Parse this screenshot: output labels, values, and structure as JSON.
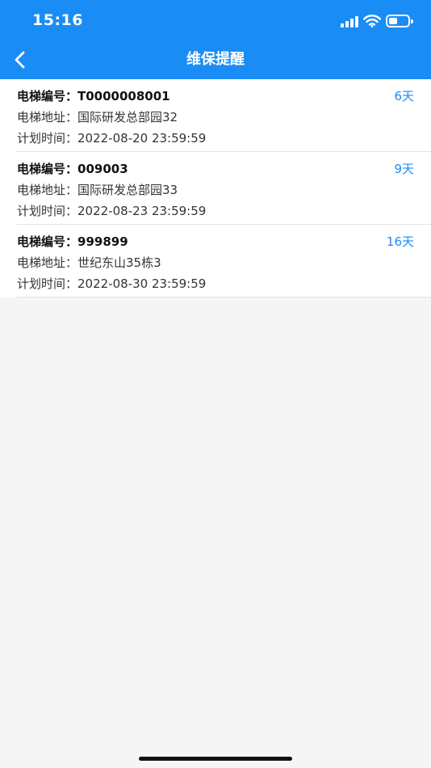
{
  "status_bar": {
    "time": "15:16",
    "battery_level": 0.45
  },
  "nav": {
    "title": "维保提醒",
    "back_icon": "chevron-left-icon"
  },
  "colors": {
    "header_bg": "#1a8cf5",
    "accent": "#1a8cf5"
  },
  "items": [
    {
      "code_label": "电梯编号：",
      "code": "T0000008001",
      "days": "6天",
      "address_label": "电梯地址：",
      "address": "国际研发总部园32",
      "time_label": "计划时间：",
      "time": "2022-08-20 23:59:59"
    },
    {
      "code_label": "电梯编号：",
      "code": "009003",
      "days": "9天",
      "address_label": "电梯地址：",
      "address": "国际研发总部园33",
      "time_label": "计划时间：",
      "time": "2022-08-23 23:59:59"
    },
    {
      "code_label": "电梯编号：",
      "code": "999899",
      "days": "16天",
      "address_label": "电梯地址：",
      "address": "世纪东山35栋3",
      "time_label": "计划时间：",
      "time": "2022-08-30 23:59:59"
    }
  ]
}
